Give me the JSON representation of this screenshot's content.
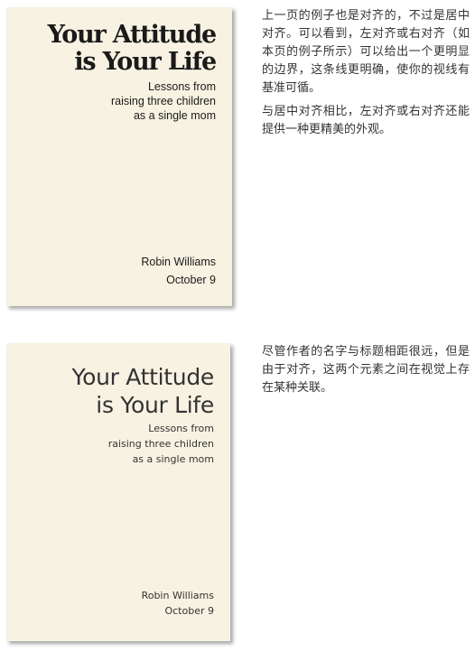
{
  "example_top": {
    "title_lines": [
      "Your Attitude",
      "is Your Life"
    ],
    "subtitle_lines": [
      "Lessons from",
      "raising three children",
      "as a single mom"
    ],
    "author": "Robin Williams",
    "date": "October 9"
  },
  "example_bottom": {
    "title_lines": [
      "Your Attitude",
      "is Your Life"
    ],
    "subtitle_lines": [
      "Lessons from",
      "raising three children",
      "as a single mom"
    ],
    "author": "Robin Williams",
    "date": "October 9"
  },
  "text_top": {
    "paragraph_1": "上一页的例子也是对齐的，不过是居中对齐。可以看到，左对齐或右对齐（如本页的例子所示）可以给出一个更明显的边界，这条线更明确，使你的视线有基准可循。",
    "paragraph_2": "与居中对齐相比，左对齐或右对齐还能提供一种更精美的外观。"
  },
  "text_bottom": {
    "paragraph_1": "尽管作者的名字与标题相距很远，但是由于对齐，这两个元素之间在视觉上存在某种关联。"
  }
}
